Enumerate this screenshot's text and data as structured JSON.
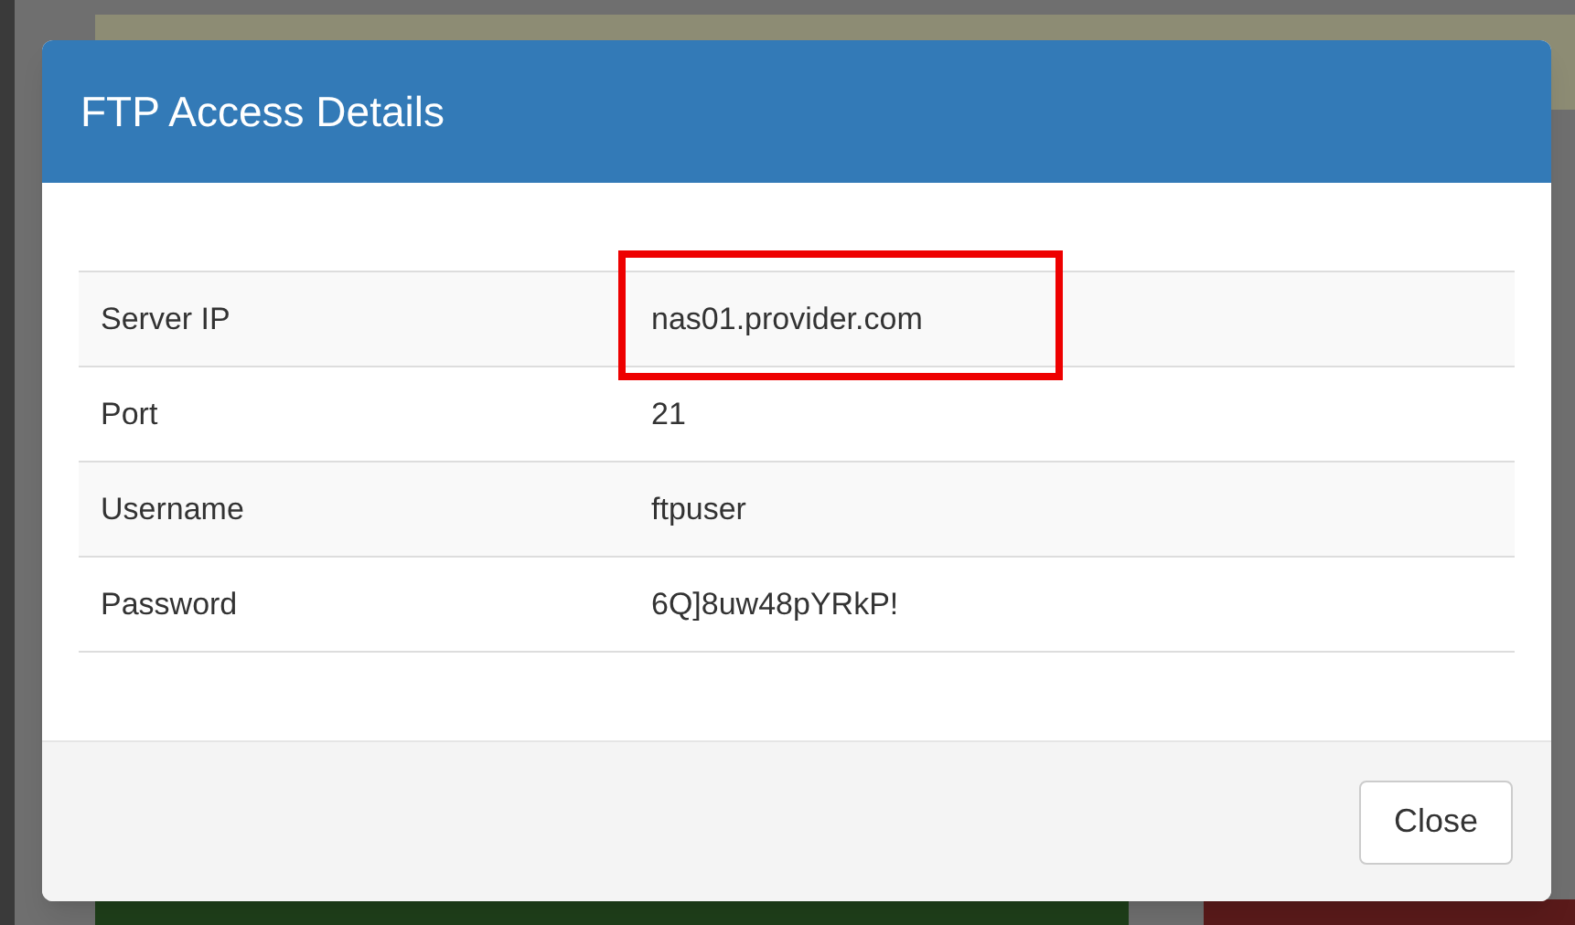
{
  "modal": {
    "title": "FTP Access Details",
    "rows": [
      {
        "label": "Server IP",
        "value": "nas01.provider.com",
        "highlighted": true
      },
      {
        "label": "Port",
        "value": "21",
        "highlighted": false
      },
      {
        "label": "Username",
        "value": "ftpuser",
        "highlighted": false
      },
      {
        "label": "Password",
        "value": "6Q]8uw48pYRkP!",
        "highlighted": false
      }
    ],
    "buttons": [
      "Close"
    ]
  }
}
